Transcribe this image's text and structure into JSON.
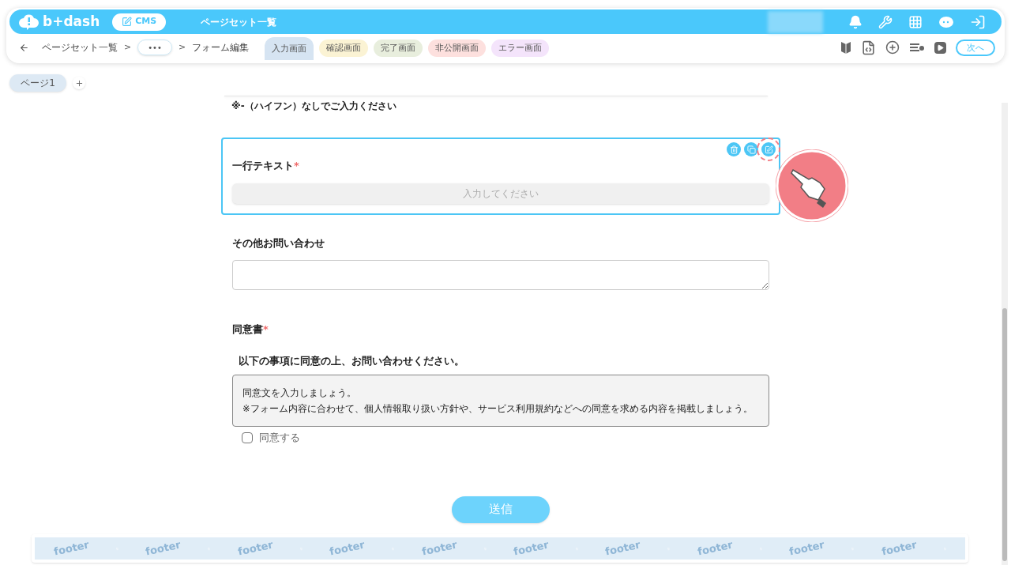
{
  "header": {
    "logo": "b+dash",
    "product": "CMS",
    "title": "ページセット一覧"
  },
  "breadcrumb": {
    "items": [
      "ページセット一覧",
      "•••",
      "フォーム編集"
    ],
    "separator": ">"
  },
  "screen_tabs": [
    {
      "label": "入力画面",
      "selected": true,
      "color": "#d6e4f2"
    },
    {
      "label": "確認画面",
      "selected": false,
      "color": "#fbf3d4"
    },
    {
      "label": "完了画面",
      "selected": false,
      "color": "#e8eedd"
    },
    {
      "label": "非公開画面",
      "selected": false,
      "color": "#fde0de"
    },
    {
      "label": "エラー画面",
      "selected": false,
      "color": "#f4e4fb"
    }
  ],
  "next_button": "次へ",
  "pages": [
    {
      "label": "ページ1",
      "selected": true
    }
  ],
  "form": {
    "hint": "※-（ハイフン）なしでご入力ください",
    "fields": [
      {
        "kind": "text",
        "label": "一行テキスト",
        "required_mark": "*",
        "placeholder": "入力してください",
        "selected": true
      },
      {
        "kind": "textarea",
        "label": "その他お問い合わせ",
        "selected": false
      },
      {
        "kind": "consent",
        "label": "同意書",
        "required_mark": "*",
        "selected": false,
        "heading": "以下の事項に同意の上、お問い合わせください。",
        "body": [
          "同意文を入力しましょう。",
          "※フォーム内容に合わせて、個人情報取り扱い方針や、サービス利用規約などへの同意を求める内容を掲載しましょう。"
        ],
        "checkbox": {
          "label": "同意する",
          "checked": false
        }
      }
    ],
    "submit": "送信"
  },
  "footer": {
    "labels": [
      "footer",
      "footer",
      "footer",
      "footer",
      "footer",
      "footer",
      "footer",
      "footer",
      "footer",
      "footer"
    ]
  }
}
